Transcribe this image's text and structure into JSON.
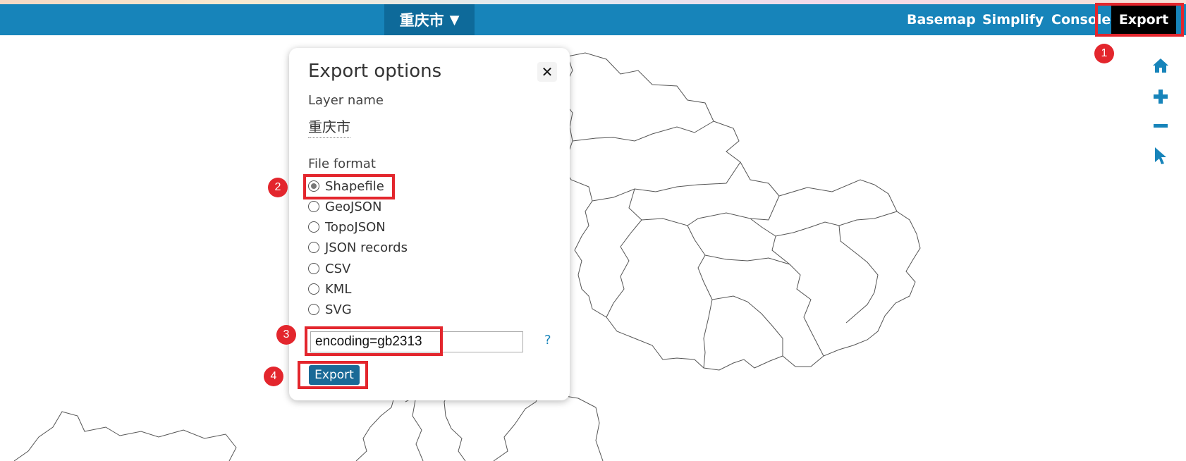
{
  "header": {
    "layer_name": "重庆市",
    "layer_caret": "▼",
    "nav": {
      "basemap": "Basemap",
      "simplify": "Simplify",
      "console": "Console",
      "export": "Export"
    }
  },
  "map_controls": [
    "home-icon",
    "zoom-in-icon",
    "zoom-out-icon",
    "select-pointer-icon"
  ],
  "dialog": {
    "title": "Export options",
    "close_symbol": "✕",
    "layer_name_label": "Layer name",
    "layer_name_value": "重庆市",
    "file_format_label": "File format",
    "formats": [
      {
        "label": "Shapefile",
        "checked": true
      },
      {
        "label": "GeoJSON",
        "checked": false
      },
      {
        "label": "TopoJSON",
        "checked": false
      },
      {
        "label": "JSON records",
        "checked": false
      },
      {
        "label": "CSV",
        "checked": false
      },
      {
        "label": "KML",
        "checked": false
      },
      {
        "label": "SVG",
        "checked": false
      }
    ],
    "options_value": "encoding=gb2313",
    "help": "?",
    "export_label": "Export"
  },
  "annotations": [
    "1",
    "2",
    "3",
    "4"
  ],
  "colors": {
    "header": "#1784ba",
    "header_dark": "#0e6a9a",
    "annotation": "#e3262d",
    "export_button": "#1a6a97"
  }
}
